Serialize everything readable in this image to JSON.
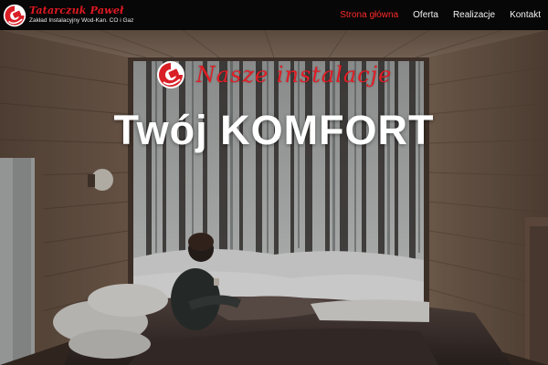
{
  "brand": {
    "name": "Tatarczuk Paweł",
    "subtitle": "Zakład Instalacyjny Wod-Kan. CO i Gaz",
    "logo_icon": "red-white-circle-logo-icon"
  },
  "nav": {
    "items": [
      {
        "label": "Strona główna",
        "active": true
      },
      {
        "label": "Oferta",
        "active": false
      },
      {
        "label": "Realizacje",
        "active": false
      },
      {
        "label": "Kontakt",
        "active": false
      }
    ],
    "active_color": "#ff2a2a"
  },
  "hero": {
    "tagline": "Nasze instalacje",
    "title": "Twój KOMFORT",
    "tagline_color": "#e21c24",
    "background": "wooden cabin interior with a large window onto a snowy forest; a person sits on a bed holding a mug"
  }
}
